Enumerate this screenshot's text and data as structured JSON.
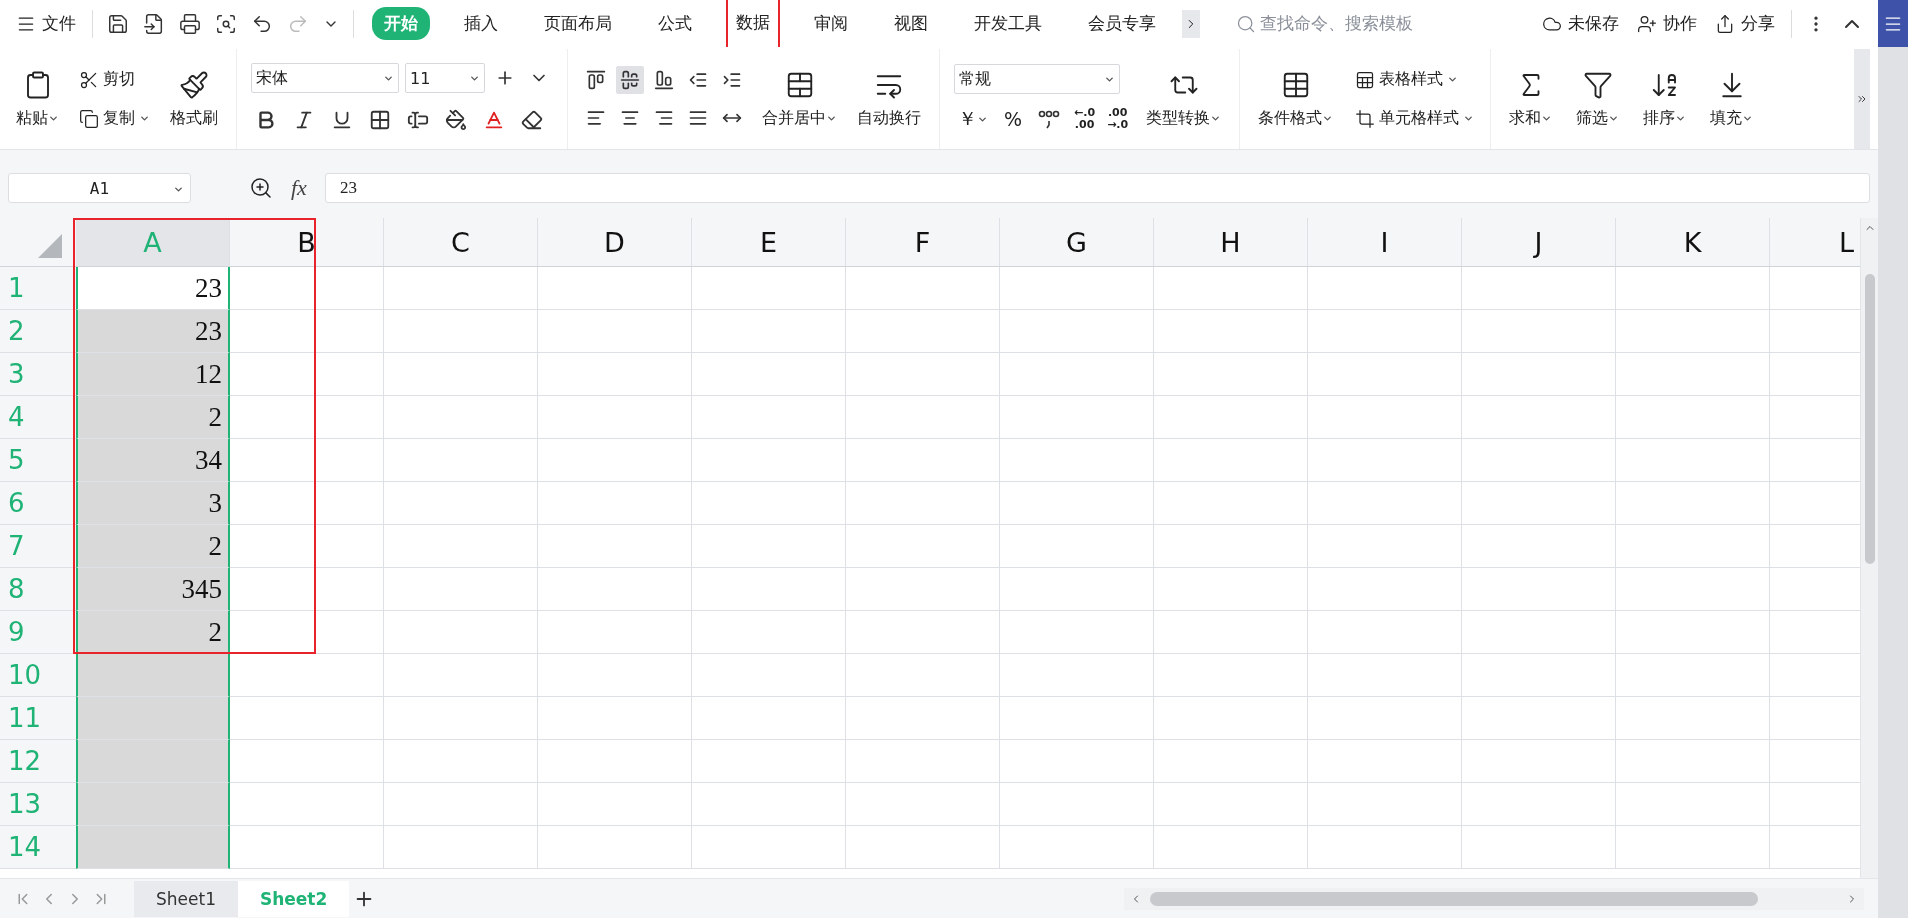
{
  "menu": {
    "file": "文件",
    "tabs": [
      {
        "label": "开始",
        "selected": true,
        "highlighted": false
      },
      {
        "label": "插入",
        "selected": false,
        "highlighted": false
      },
      {
        "label": "页面布局",
        "selected": false,
        "highlighted": false
      },
      {
        "label": "公式",
        "selected": false,
        "highlighted": false
      },
      {
        "label": "数据",
        "selected": false,
        "highlighted": true
      },
      {
        "label": "审阅",
        "selected": false,
        "highlighted": false
      },
      {
        "label": "视图",
        "selected": false,
        "highlighted": false
      },
      {
        "label": "开发工具",
        "selected": false,
        "highlighted": false
      },
      {
        "label": "会员专享",
        "selected": false,
        "highlighted": false
      }
    ],
    "search_placeholder": "查找命令、搜索模板",
    "unsaved": "未保存",
    "collaborate": "协作",
    "share": "分享"
  },
  "ribbon": {
    "paste": "粘贴",
    "cut": "剪切",
    "copy": "复制",
    "format_painter": "格式刷",
    "font": "宋体",
    "font_size": "11",
    "merge": "合并居中",
    "wrap": "自动换行",
    "number_format": "常规",
    "currency": "￥",
    "percent": "%",
    "increase_decimal": [
      "←.0",
      ".00"
    ],
    "decrease_decimal": [
      ".00",
      "→.0"
    ],
    "convert": "类型转换",
    "conditional_format": "条件格式",
    "table_style": "表格样式",
    "cell_style": "单元格样式",
    "sum": "求和",
    "filter": "筛选",
    "sort": "排序",
    "fill": "填充"
  },
  "formula_bar": {
    "name_box": "A1",
    "fx": "fx",
    "value": "23"
  },
  "sheet": {
    "highlight_frame": true,
    "columns": [
      {
        "label": "A",
        "selected": true
      },
      {
        "label": "B",
        "selected": false
      },
      {
        "label": "C",
        "selected": false
      },
      {
        "label": "D",
        "selected": false
      },
      {
        "label": "E",
        "selected": false
      },
      {
        "label": "F",
        "selected": false
      },
      {
        "label": "G",
        "selected": false
      },
      {
        "label": "H",
        "selected": false
      },
      {
        "label": "I",
        "selected": false
      },
      {
        "label": "J",
        "selected": false
      },
      {
        "label": "K",
        "selected": false
      },
      {
        "label": "L",
        "selected": false
      }
    ],
    "rows": [
      {
        "label": "1",
        "value": "23"
      },
      {
        "label": "2",
        "value": "23"
      },
      {
        "label": "3",
        "value": "12"
      },
      {
        "label": "4",
        "value": "2"
      },
      {
        "label": "5",
        "value": "34"
      },
      {
        "label": "6",
        "value": "3"
      },
      {
        "label": "7",
        "value": "2"
      },
      {
        "label": "8",
        "value": "345"
      },
      {
        "label": "9",
        "value": "2"
      },
      {
        "label": "10"
      },
      {
        "label": "11"
      },
      {
        "label": "12"
      },
      {
        "label": "13"
      },
      {
        "label": "14"
      }
    ]
  },
  "sheet_tabs": [
    {
      "label": "Sheet1",
      "selected": false
    },
    {
      "label": "Sheet2",
      "selected": true
    }
  ]
}
